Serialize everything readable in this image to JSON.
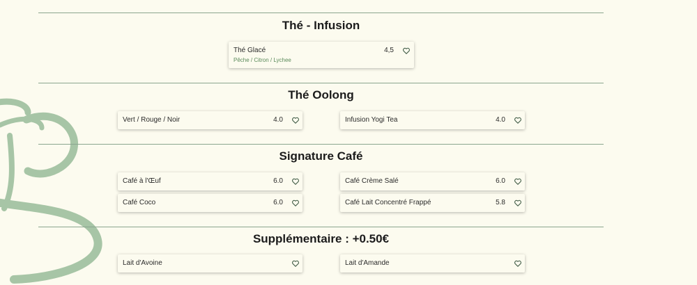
{
  "sections": [
    {
      "title": "Thé - Infusion"
    },
    {
      "title": "Thé Oolong"
    },
    {
      "title": "Signature Café"
    },
    {
      "title": "Supplémentaire : +0.50€"
    }
  ],
  "items": {
    "the_glace": {
      "name": "Thé Glacé",
      "price": "4,5",
      "desc": "Pêche / Citron / Lychee"
    },
    "vert_rouge_noir": {
      "name": "Vert / Rouge / Noir",
      "price": "4.0"
    },
    "infusion_yogi": {
      "name": "Infusion Yogi Tea",
      "price": "4.0"
    },
    "cafe_oeuf": {
      "name": "Café à l'Œuf",
      "price": "6.0"
    },
    "cafe_creme_sale": {
      "name": "Café Crème Salé",
      "price": "6.0"
    },
    "cafe_coco": {
      "name": "Café Coco",
      "price": "6.0"
    },
    "cafe_lait_frappe": {
      "name": "Café Lait Concentré Frappé",
      "price": "5.8"
    },
    "lait_avoine": {
      "name": "Lait d'Avoine"
    },
    "lait_amande": {
      "name": "Lait d'Amande"
    }
  },
  "icons": {
    "favorite": "heart-outline-icon",
    "background": "coffee-cup-icon"
  },
  "colors": {
    "background": "#fcfbef",
    "accent": "#8aa58e",
    "heart": "#3e5a44",
    "subtext": "#5a8a5a"
  }
}
